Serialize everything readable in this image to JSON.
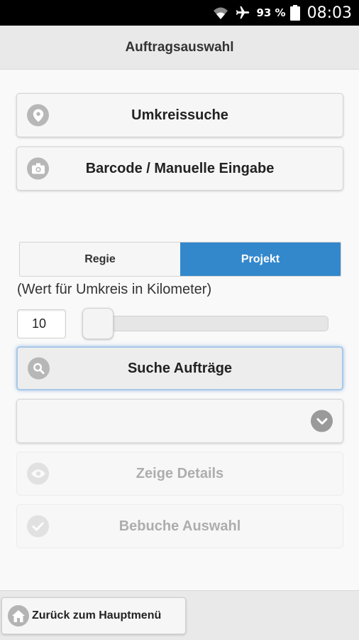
{
  "statusbar": {
    "battery": "93 %",
    "time": "08:03",
    "icons": [
      "wifi-icon",
      "airplane-icon",
      "battery-icon"
    ]
  },
  "header": {
    "title": "Auftragsauswahl"
  },
  "buttons": {
    "radius_search": {
      "label": "Umkreissuche",
      "icon": "location-pin-icon"
    },
    "barcode": {
      "label": "Barcode / Manuelle Eingabe",
      "icon": "camera-icon"
    },
    "search_orders": {
      "label": "Suche Aufträge",
      "icon": "search-icon"
    },
    "show_details": {
      "label": "Zeige Details",
      "icon": "eye-icon",
      "disabled": true
    },
    "book_selection": {
      "label": "Bebuche Auswahl",
      "icon": "check-icon",
      "disabled": true
    }
  },
  "segmented": {
    "options": [
      "Regie",
      "Projekt"
    ],
    "selected": "Projekt"
  },
  "radius": {
    "hint": "(Wert für Umkreis in Kilometer)",
    "value": "10",
    "slider_fraction": 0.0
  },
  "select": {
    "value": "",
    "icon": "chevron-down-icon"
  },
  "footer": {
    "back_label": "Zurück zum Hauptmenü",
    "icon": "home-icon"
  },
  "colors": {
    "accent": "#3388cc",
    "icon_bg": "#b7b7b7"
  }
}
